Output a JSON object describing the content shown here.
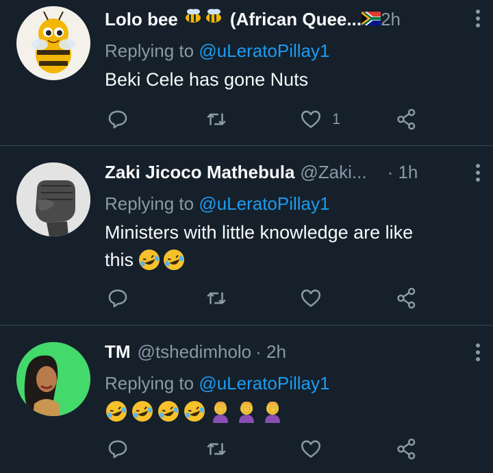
{
  "tweets": [
    {
      "name": "Lolo bee",
      "name_suffix": "(African Quee...",
      "handle": "",
      "time": "2h",
      "replying_prefix": "Replying to",
      "replying_to": "@uLeratoPillay1",
      "text": "Beki Cele has gone Nuts",
      "like_count": "1"
    },
    {
      "name": "Zaki Jicoco Mathebula",
      "handle": "@Zaki...",
      "time": "· 1h",
      "replying_prefix": "Replying to",
      "replying_to": "@uLeratoPillay1",
      "text_line1": "Ministers with little knowledge are like",
      "text_line2": "this"
    },
    {
      "name": "TM",
      "handle": "@tshedimholo",
      "time": "· 2h",
      "replying_prefix": "Replying to",
      "replying_to": "@uLeratoPillay1"
    }
  ],
  "colors": {
    "background": "#15202b",
    "divider": "#38444d",
    "secondary_text": "#8b98a5",
    "link": "#1d9bf0"
  },
  "icons": [
    "reply-icon",
    "retweet-icon",
    "like-icon",
    "share-icon",
    "more-icon"
  ]
}
